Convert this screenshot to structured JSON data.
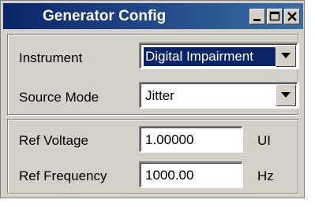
{
  "window": {
    "title": "Generator Config",
    "controls": {
      "minimize": "minimize-icon",
      "maximize": "maximize-icon",
      "close": "close-icon"
    }
  },
  "group1": {
    "instrument": {
      "label": "Instrument",
      "value": "Digital Impairment",
      "state": "focused"
    },
    "source_mode": {
      "label": "Source Mode",
      "value": "Jitter"
    }
  },
  "group2": {
    "ref_voltage": {
      "label": "Ref Voltage",
      "value": "1.00000",
      "unit": "UI"
    },
    "ref_frequency": {
      "label": "Ref Frequency",
      "value": "1000.00",
      "unit": "Hz"
    }
  },
  "colors": {
    "titlebar_start": "#0a246a",
    "titlebar_end": "#3a6ea5",
    "window_bg": "#d4d0c8"
  }
}
